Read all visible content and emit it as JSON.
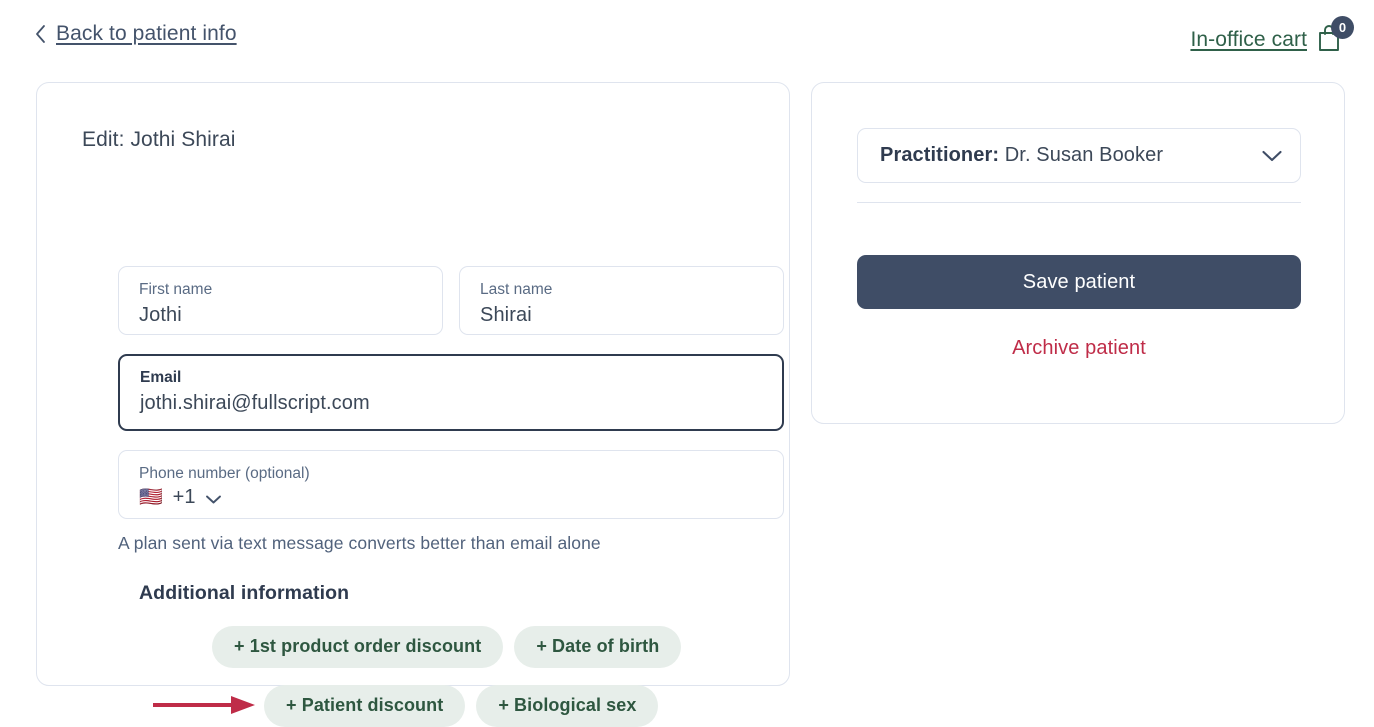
{
  "topbar": {
    "back_label": "Back to patient info",
    "back_icon": "chevron-left-icon",
    "cart_label": "In-office cart",
    "cart_icon": "shopping-bag-icon",
    "cart_badge_count": "0"
  },
  "patient_form": {
    "title": "Edit: Jothi Shirai",
    "fields": [
      {
        "label": "First name",
        "value": "Jothi",
        "focused": false
      },
      {
        "label": "Last name",
        "value": "Shirai",
        "focused": false
      },
      {
        "label": "Email",
        "value": "jothi.shirai@fullscript.com",
        "focused": true
      },
      {
        "label": "Phone number (optional)",
        "value": "+1",
        "focused": false,
        "flag": "🇺🇸",
        "chevron_icon": "chevron-down-icon"
      }
    ],
    "helper_text": "A plan sent via text message converts better than email alone",
    "additional_information": {
      "heading": "Additional information",
      "row_1": [
        "+ 1st product order discount",
        "+ Date of birth"
      ],
      "row_2": [
        "+ Patient discount",
        "+ Biological sex"
      ]
    },
    "annotation": {
      "type": "arrow",
      "points_to": "+ Patient discount",
      "color": "#bf2c48"
    }
  },
  "sidebar_panel": {
    "practitioner_prefix": "Practitioner:",
    "practitioner_name": " Dr. Susan Booker",
    "practitioner_chevron_icon": "chevron-down-icon",
    "save_label": "Save patient",
    "archive_label": "Archive patient"
  },
  "colors": {
    "text_primary": "#3c4858",
    "text_heading": "#2f3b4f",
    "green_link": "#2f6049",
    "pill_bg": "#e7eeea",
    "pill_text": "#2e5740",
    "navy_button": "#3f4d66",
    "danger": "#bf2c48",
    "border": "#dfe4ee"
  }
}
